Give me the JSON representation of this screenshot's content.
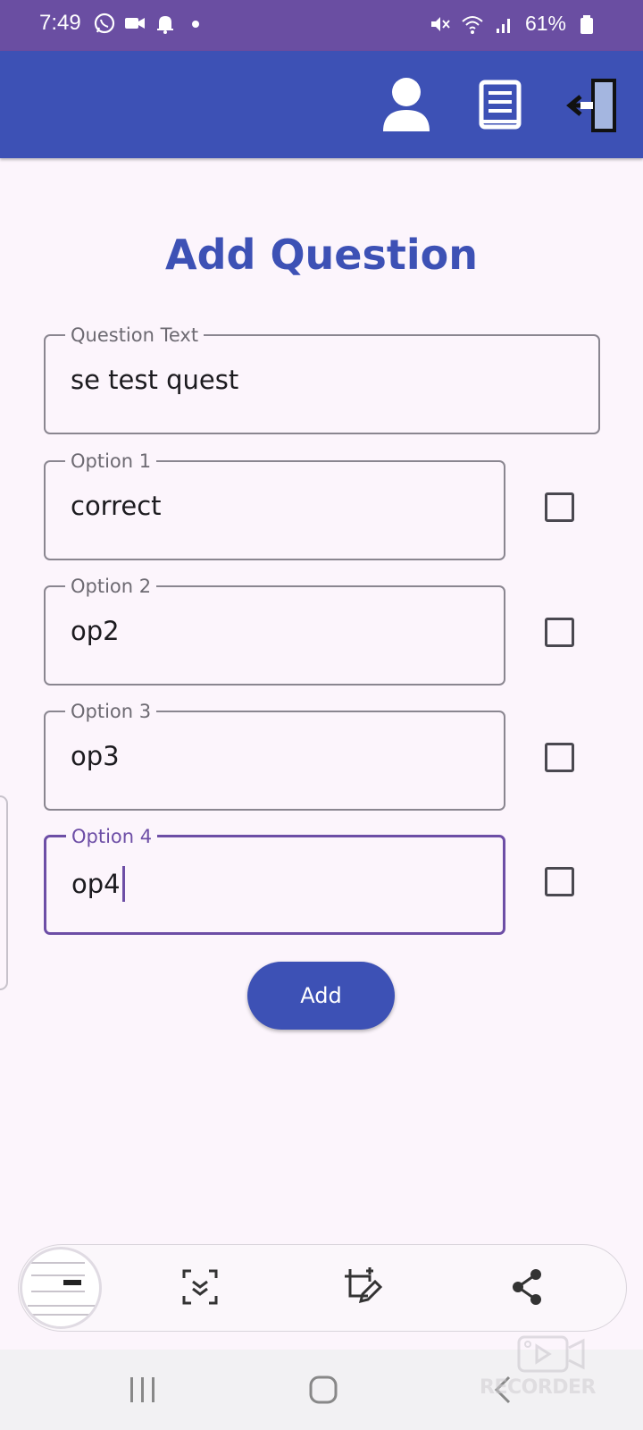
{
  "status_bar": {
    "time": "7:49",
    "battery": "61%",
    "left_icons": [
      "whatsapp-icon",
      "video-icon",
      "bell-icon",
      "dot-icon"
    ],
    "right_icons": [
      "mute-icon",
      "wifi-icon",
      "signal-icon",
      "battery-icon"
    ]
  },
  "app_bar": {
    "icons": [
      "person-icon",
      "book-icon",
      "logout-icon"
    ],
    "color": "#3d51b5"
  },
  "page": {
    "title": "Add Question"
  },
  "form": {
    "question": {
      "label": "Question Text",
      "value": "se test quest"
    },
    "options": [
      {
        "label": "Option 1",
        "value": "correct",
        "checked": false
      },
      {
        "label": "Option 2",
        "value": "op2",
        "checked": false
      },
      {
        "label": "Option 3",
        "value": "op3",
        "checked": false
      },
      {
        "label": "Option 4",
        "value": "op4",
        "checked": false,
        "focused": true
      }
    ],
    "submit_label": "Add"
  },
  "screenshot_toolbar": {
    "icons": [
      "scroll-capture-icon",
      "crop-edit-icon",
      "share-icon"
    ]
  },
  "nav_bar": {
    "icons": [
      "recents-icon",
      "home-icon",
      "back-icon"
    ]
  },
  "watermark": {
    "text": "RECORDER"
  },
  "colors": {
    "status_bar": "#6a4ea2",
    "primary": "#3d51b5",
    "focus": "#6d4ea6",
    "background": "#fcf5fc"
  }
}
